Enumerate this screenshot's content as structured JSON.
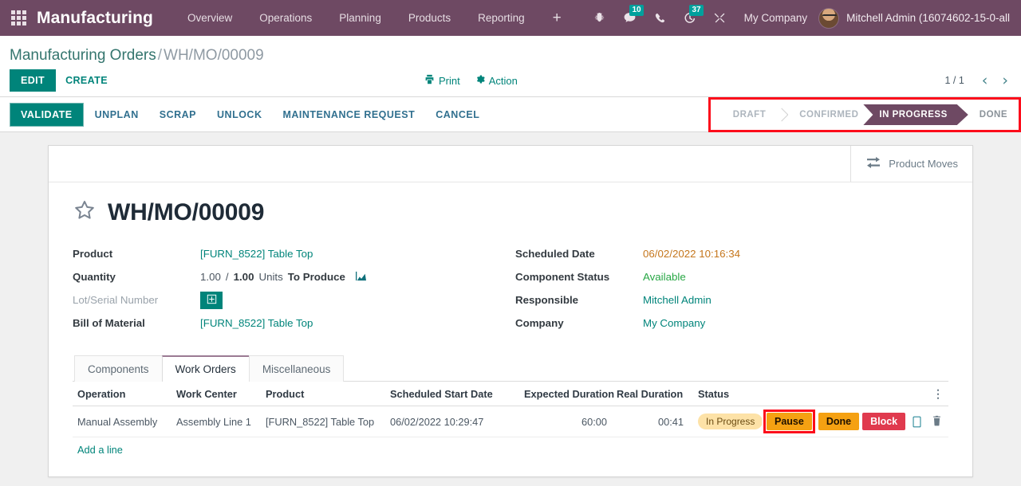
{
  "navbar": {
    "apps_icon": "apps-grid-icon",
    "brand": "Manufacturing",
    "menu": [
      {
        "label": "Overview"
      },
      {
        "label": "Operations"
      },
      {
        "label": "Planning"
      },
      {
        "label": "Products"
      },
      {
        "label": "Reporting"
      }
    ],
    "plus_label": "+",
    "sysicons": [
      {
        "name": "bug-icon",
        "count": ""
      },
      {
        "name": "messages-icon",
        "count": "10"
      },
      {
        "name": "phone-icon",
        "count": ""
      },
      {
        "name": "activities-clock-icon",
        "count": "37"
      },
      {
        "name": "tools-icon",
        "count": ""
      }
    ],
    "company": "My Company",
    "user": "Mitchell Admin (16074602-15-0-all"
  },
  "control_panel": {
    "breadcrumb_root": "Manufacturing Orders",
    "breadcrumb_sep": "/",
    "breadcrumb_current": "WH/MO/00009",
    "edit_label": "EDIT",
    "create_label": "CREATE",
    "print_label": "Print",
    "action_label": "Action",
    "pager_value": "1 / 1",
    "pager_prev": "‹",
    "pager_next": "›"
  },
  "statusbar_buttons": [
    {
      "label": "VALIDATE",
      "primary": true
    },
    {
      "label": "UNPLAN",
      "primary": false
    },
    {
      "label": "SCRAP",
      "primary": false
    },
    {
      "label": "UNLOCK",
      "primary": false
    },
    {
      "label": "MAINTENANCE REQUEST",
      "primary": false
    },
    {
      "label": "CANCEL",
      "primary": false
    }
  ],
  "statusbar": {
    "highlight_color": "#fc0d1b",
    "active_color": "#6e4963",
    "steps": [
      {
        "label": "DRAFT",
        "active": false
      },
      {
        "label": "CONFIRMED",
        "active": false
      },
      {
        "label": "IN PROGRESS",
        "active": true
      },
      {
        "label": "DONE",
        "active": false
      }
    ]
  },
  "stat_buttons": [
    {
      "label": "Product Moves",
      "icon": "exchange-arrows-icon"
    }
  ],
  "record": {
    "title": "WH/MO/00009",
    "favorite_icon": "star-outline-icon"
  },
  "fields_left": [
    {
      "label": "Product",
      "value": "[FURN_8522] Table Top",
      "style": "link"
    },
    {
      "label": "Quantity",
      "value": "",
      "style": "quantity"
    },
    {
      "label": "Lot/Serial Number",
      "value": "",
      "style": "button",
      "label_muted": true
    },
    {
      "label": "Bill of Material",
      "value": "[FURN_8522] Table Top",
      "style": "link"
    }
  ],
  "quantity": {
    "produced": "1.00",
    "separator": "/",
    "target": "1.00",
    "uom": "Units",
    "suffix": "To Produce",
    "chart_icon": "area-chart-icon"
  },
  "lot_serial_button_icon": "plus-box-icon",
  "fields_right": [
    {
      "label": "Scheduled Date",
      "value": "06/02/2022 10:16:34",
      "style": "orange"
    },
    {
      "label": "Component Status",
      "value": "Available",
      "style": "green"
    },
    {
      "label": "Responsible",
      "value": "Mitchell Admin",
      "style": "link"
    },
    {
      "label": "Company",
      "value": "My Company",
      "style": "link"
    }
  ],
  "tabs": [
    {
      "label": "Components",
      "active": false
    },
    {
      "label": "Work Orders",
      "active": true
    },
    {
      "label": "Miscellaneous",
      "active": false
    }
  ],
  "work_orders": {
    "columns": [
      "Operation",
      "Work Center",
      "Product",
      "Scheduled Start Date",
      "Expected Duration",
      "Real Duration",
      "Status"
    ],
    "optional_columns_icon": "vertical-dots-icon",
    "rows": [
      {
        "operation": "Manual Assembly",
        "work_center": "Assembly Line 1",
        "product": "[FURN_8522] Table Top",
        "scheduled_start_date": "06/02/2022 10:29:47",
        "expected_duration": "60:00",
        "real_duration": "00:41",
        "status": "In Progress",
        "buttons": [
          {
            "label": "Pause",
            "kind": "pause",
            "highlighted": true
          },
          {
            "label": "Done",
            "kind": "done",
            "highlighted": false
          },
          {
            "label": "Block",
            "kind": "block",
            "highlighted": false
          }
        ],
        "tablet_icon": "tablet-icon",
        "delete_icon": "trash-icon"
      }
    ],
    "add_line_label": "Add a line"
  }
}
